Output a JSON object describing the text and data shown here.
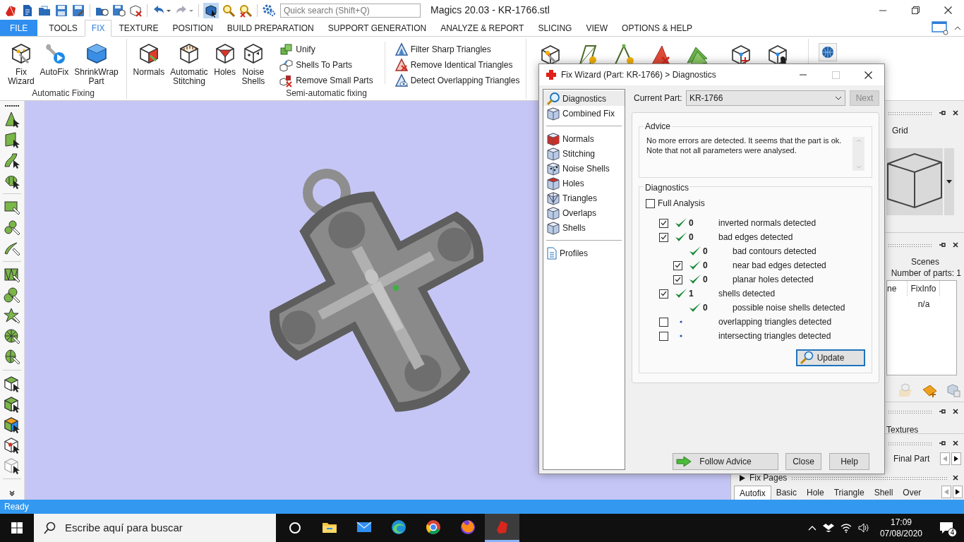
{
  "window": {
    "title": "Magics 20.03 - KR-1766.stl"
  },
  "quick_search": {
    "placeholder": "Quick search (Shift+Q)"
  },
  "ribbon_tabs": [
    {
      "label": "FILE",
      "kind": "file",
      "selected": false
    },
    {
      "label": "TOOLS",
      "kind": "tab",
      "selected": false
    },
    {
      "label": "FIX",
      "kind": "tab",
      "selected": true
    },
    {
      "label": "TEXTURE",
      "kind": "tab",
      "selected": false
    },
    {
      "label": "POSITION",
      "kind": "tab",
      "selected": false
    },
    {
      "label": "BUILD PREPARATION",
      "kind": "tab",
      "selected": false
    },
    {
      "label": "SUPPORT GENERATION",
      "kind": "tab",
      "selected": false
    },
    {
      "label": "ANALYZE & REPORT",
      "kind": "tab",
      "selected": false
    },
    {
      "label": "SLICING",
      "kind": "tab",
      "selected": false
    },
    {
      "label": "VIEW",
      "kind": "tab",
      "selected": false
    },
    {
      "label": "OPTIONS & HELP",
      "kind": "tab",
      "selected": false
    }
  ],
  "ribbon_groups": [
    {
      "label": "Automatic Fixing",
      "buttons": [
        {
          "label": "Fix Wizard"
        },
        {
          "label": "AutoFix"
        },
        {
          "label": "ShrinkWrap Part"
        }
      ]
    },
    {
      "label": "Semi-automatic fixing",
      "buttons": [
        {
          "label": "Normals"
        },
        {
          "label": "Automatic Stitching"
        },
        {
          "label": "Holes"
        },
        {
          "label": "Noise Shells"
        }
      ],
      "small_button_columns": [
        [
          {
            "label": "Unify"
          },
          {
            "label": "Shells To Parts"
          },
          {
            "label": "Remove Small Parts"
          }
        ],
        [
          {
            "label": "Filter Sharp Triangles"
          },
          {
            "label": "Remove Identical Triangles"
          },
          {
            "label": "Detect Overlapping Triangles"
          }
        ]
      ]
    }
  ],
  "dialog": {
    "title": "Fix Wizard (Part: KR-1766) > Diagnostics",
    "nav_sections": [
      {
        "items": [
          {
            "label": "Diagnostics",
            "selected": true
          },
          {
            "label": "Combined Fix",
            "selected": false
          }
        ]
      },
      {
        "items": [
          {
            "label": "Normals",
            "selected": false
          },
          {
            "label": "Stitching",
            "selected": false
          },
          {
            "label": "Noise Shells",
            "selected": false
          },
          {
            "label": "Holes",
            "selected": false
          },
          {
            "label": "Triangles",
            "selected": false
          },
          {
            "label": "Overlaps",
            "selected": false
          },
          {
            "label": "Shells",
            "selected": false
          }
        ]
      },
      {
        "items": [
          {
            "label": "Profiles",
            "selected": false
          }
        ]
      }
    ],
    "current_part_label": "Current Part:",
    "current_part": "KR-1766",
    "next_button": {
      "label": "Next",
      "disabled": true
    },
    "advice": {
      "title": "Advice",
      "lines": [
        "No more errors are detected. It seems that the part is ok.",
        "Note that not all parameters were analysed."
      ]
    },
    "diagnostics": {
      "title": "Diagnostics",
      "full_analysis": {
        "label": "Full Analysis",
        "checked": false
      },
      "rows": [
        {
          "checked": true,
          "passed": true,
          "count": "0",
          "label": "inverted normals detected"
        },
        {
          "checked": true,
          "passed": true,
          "count": "0",
          "label": "bad edges detected",
          "children": [
            {
              "passed": true,
              "count": "0",
              "label": "bad contours detected"
            },
            {
              "checked": true,
              "passed": true,
              "count": "0",
              "label": "near bad edges detected"
            },
            {
              "checked": true,
              "passed": true,
              "count": "0",
              "label": "planar holes detected"
            }
          ]
        },
        {
          "checked": true,
          "passed": true,
          "count": "1",
          "label": "shells detected",
          "children": [
            {
              "passed": true,
              "count": "0",
              "label": "possible noise shells detected"
            }
          ]
        },
        {
          "checked": false,
          "passed": false,
          "label": "overlapping triangles detected"
        },
        {
          "checked": false,
          "passed": false,
          "label": "intersecting triangles detected"
        }
      ],
      "update_button": "Update"
    },
    "buttons": [
      {
        "label": "Follow Advice",
        "kind": "advice"
      },
      {
        "label": "Close",
        "kind": "plain"
      },
      {
        "label": "Help",
        "kind": "plain"
      }
    ]
  },
  "right_panels": {
    "view_panel": {
      "label": "Grid"
    },
    "scenes_panel": {
      "title": "Scenes",
      "part_count": "Number of parts: 1",
      "columns": [
        "ne",
        "FixInfo"
      ],
      "rows": [
        {
          "fixinfo": "n/a"
        }
      ]
    },
    "textures_panel": {
      "title": "Textures"
    },
    "part_panel": {
      "label": "Final Part"
    },
    "fix_pages": {
      "title": "Fix Pages",
      "tabs": [
        {
          "label": "Autofix",
          "selected": true
        },
        {
          "label": "Basic",
          "selected": false
        },
        {
          "label": "Hole",
          "selected": false
        },
        {
          "label": "Triangle",
          "selected": false
        },
        {
          "label": "Shell",
          "selected": false
        },
        {
          "label": "Over",
          "selected": false
        }
      ]
    }
  },
  "status_bar": {
    "text": "Ready"
  },
  "taskbar": {
    "search_placeholder": "Escribe aquí para buscar",
    "apps": [
      {
        "active": false
      },
      {
        "active": false
      },
      {
        "active": false
      },
      {
        "active": false
      },
      {
        "active": false
      },
      {
        "active": true
      }
    ],
    "time": "17:09",
    "date": "07/08/2020",
    "notifications": "4"
  }
}
